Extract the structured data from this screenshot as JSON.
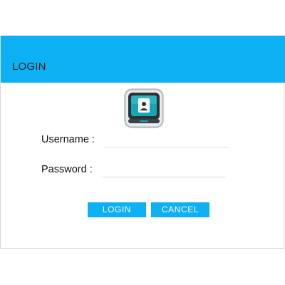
{
  "dialog": {
    "title": "LOGIN",
    "accent_color": "#0db0f2",
    "logo_icon": "monitor-user-icon"
  },
  "form": {
    "username_label": "Username :",
    "username_value": "",
    "password_label": "Password :",
    "password_value": ""
  },
  "buttons": {
    "login_label": "LOGIN",
    "cancel_label": "CANCEL"
  }
}
